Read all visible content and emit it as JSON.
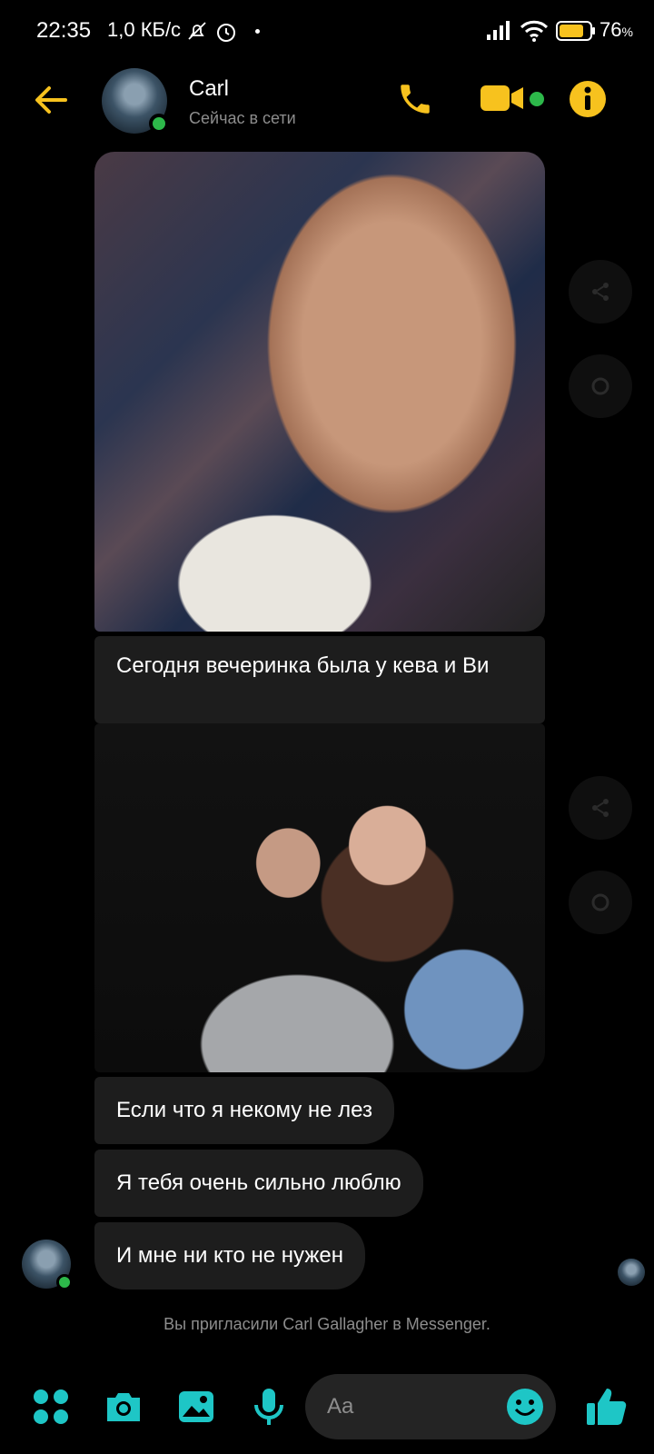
{
  "status_bar": {
    "time": "22:35",
    "speed": "1,0 КБ/с",
    "battery": "76",
    "battery_unit": "%"
  },
  "header": {
    "contact_name": "Carl",
    "status": "Сейчас в сети",
    "accent_color": "#f7c21e",
    "online_color": "#2db84a"
  },
  "messages": [
    {
      "type": "image",
      "name": "photo-selfie"
    },
    {
      "type": "text",
      "text": "Сегодня вечеринка была у кева и Ви"
    },
    {
      "type": "image",
      "name": "photo-party"
    },
    {
      "type": "text",
      "text": "Если что я некому не лез"
    },
    {
      "type": "text",
      "text": "Я тебя очень сильно люблю"
    },
    {
      "type": "text",
      "text": "И мне ни кто не нужен"
    }
  ],
  "notice": "Вы пригласили Carl Gallagher в Messenger.",
  "composer": {
    "placeholder": "Aa",
    "icon_color": "#1ec6c6"
  },
  "icons": [
    "back-arrow-icon",
    "phone-icon",
    "video-camera-icon",
    "info-icon",
    "share-icon",
    "apps-icon",
    "camera-icon",
    "gallery-icon",
    "microphone-icon",
    "emoji-icon",
    "thumbs-up-icon"
  ]
}
